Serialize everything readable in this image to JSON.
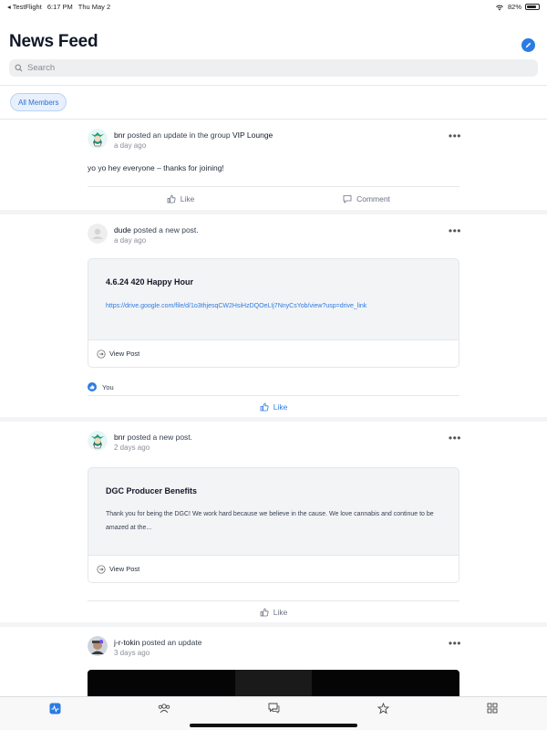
{
  "status": {
    "back_app": "◂ TestFlight",
    "time": "6:17 PM",
    "date": "Thu May 2",
    "battery": "82%"
  },
  "header": {
    "title": "News Feed"
  },
  "search": {
    "placeholder": "Search"
  },
  "filter": {
    "chip_label": "All Members"
  },
  "posts": [
    {
      "author": "bnr",
      "action": "posted an update in the group",
      "group": "VIP Lounge",
      "time": "a day ago",
      "text": "yo yo hey everyone – thanks for joining!",
      "like_label": "Like",
      "comment_label": "Comment"
    },
    {
      "author": "dude",
      "action": "posted a new post.",
      "time": "a day ago",
      "card_title": "4.6.24 420 Happy Hour",
      "card_link": "https://drive.google.com/file/d/1o3thjesqCW2HsiHzDQOeLIj7NnyCsYob/view?usp=drive_link",
      "view_post_label": "View Post",
      "liked_by": "You",
      "like_label": "Like"
    },
    {
      "author": "bnr",
      "action": "posted a new post.",
      "time": "2 days ago",
      "card_title": "DGC Producer Benefits",
      "card_body": "Thank you for being the DGC! We work hard because we believe in the cause. We love cannabis and continue to be amazed at the...",
      "view_post_label": "View Post",
      "like_label": "Like"
    },
    {
      "author": "j-r-tokin",
      "action": "posted an update",
      "time": "3 days ago"
    }
  ],
  "tabs": [
    {
      "icon": "activity-icon",
      "active": true
    },
    {
      "icon": "members-icon",
      "active": false
    },
    {
      "icon": "messages-icon",
      "active": false
    },
    {
      "icon": "star-icon",
      "active": false
    },
    {
      "icon": "grid-icon",
      "active": false
    }
  ],
  "colors": {
    "accent": "#2b7be4",
    "feed_bg": "#f3f4f6",
    "text": "#111827",
    "muted": "#8b8f98"
  }
}
